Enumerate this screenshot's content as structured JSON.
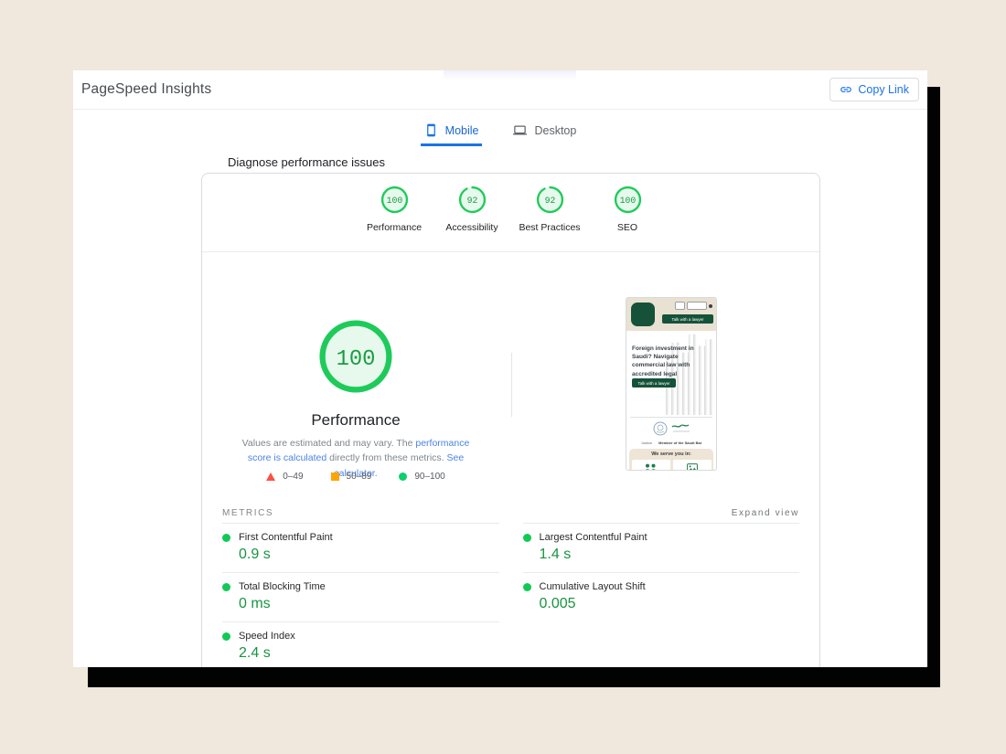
{
  "colors": {
    "green_ring": "#1ecb5a",
    "green_fill": "#e7f9ec",
    "green_text": "#189c45",
    "green_value": "#17953f",
    "green_dot": "#12c956",
    "red": "#ff4e42",
    "orange": "#ffa400",
    "legend_green": "#0cce6b",
    "blue": "#1a73e8"
  },
  "header": {
    "title": "PageSpeed Insights",
    "copy_link_label": "Copy Link"
  },
  "tabs": [
    {
      "label": "Mobile",
      "active": true
    },
    {
      "label": "Desktop",
      "active": false
    }
  ],
  "diagnose_label": "Diagnose performance issues",
  "categories": [
    {
      "label": "Performance",
      "score": 100
    },
    {
      "label": "Accessibility",
      "score": 92
    },
    {
      "label": "Best Practices",
      "score": 92
    },
    {
      "label": "SEO",
      "score": 100
    }
  ],
  "performance_section": {
    "score": 100,
    "title": "Performance",
    "description_parts": [
      {
        "text": "Values are estimated and may vary. The "
      },
      {
        "link": "performance score is calculated"
      },
      {
        "text": " directly from these metrics. "
      },
      {
        "link": "See calculator."
      }
    ],
    "legend": [
      {
        "shape": "triangle",
        "range": "0–49"
      },
      {
        "shape": "square",
        "range": "50–89"
      },
      {
        "shape": "circle",
        "range": "90–100"
      }
    ]
  },
  "metrics_section": {
    "heading": "METRICS",
    "expand_label": "Expand view",
    "left": [
      {
        "label": "First Contentful Paint",
        "value": "0.9 s"
      },
      {
        "label": "Total Blocking Time",
        "value": "0 ms"
      },
      {
        "label": "Speed Index",
        "value": "2.4 s"
      }
    ],
    "right": [
      {
        "label": "Largest Contentful Paint",
        "value": "1.4 s"
      },
      {
        "label": "Cumulative Layout Shift",
        "value": "0.005"
      }
    ]
  },
  "thumbnail": {
    "header_button": "Talk with a lawyer",
    "hero_text": "Foreign investment in Saudi? Navigate commercial law with accredited legal support.",
    "hero_button": "Talk with a lawyer",
    "caption_left": "Justice",
    "caption_right": "Member of the Saudi Bar",
    "serve_title": "We serve you in:"
  }
}
